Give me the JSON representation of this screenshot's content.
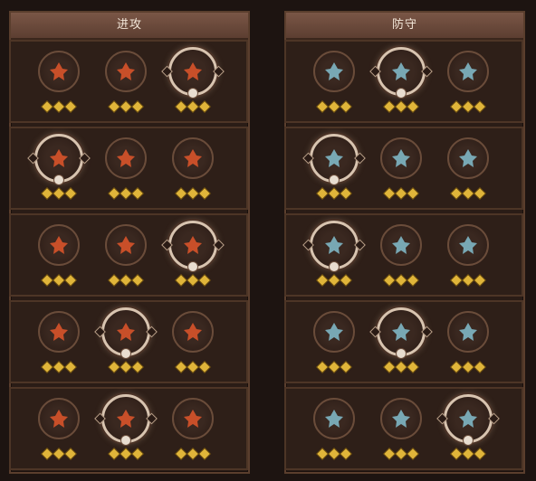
{
  "panels": {
    "attack": {
      "title": "进攻"
    },
    "defense": {
      "title": "防守"
    }
  },
  "colors": {
    "attack_glyph": "#d8532a",
    "attack_glyph_dim": "#b0462a",
    "defense_glyph": "#7fb6c4",
    "pip": "#e0b53a",
    "selected_ring": "#d8c4b0"
  },
  "attack_rows": [
    {
      "nodes": [
        {
          "icon": "crosshair-rune-icon",
          "selected": false
        },
        {
          "icon": "horned-demon-icon",
          "selected": false
        },
        {
          "icon": "flame-fist-icon",
          "selected": true
        }
      ]
    },
    {
      "nodes": [
        {
          "icon": "triple-claw-icon",
          "selected": true
        },
        {
          "icon": "honeycomb-fist-icon",
          "selected": false
        },
        {
          "icon": "fire-warrior-icon",
          "selected": false
        }
      ]
    },
    {
      "nodes": [
        {
          "icon": "bleeding-blade-icon",
          "selected": false
        },
        {
          "icon": "arrow-strike-icon",
          "selected": false
        },
        {
          "icon": "hooded-flame-icon",
          "selected": true
        }
      ]
    },
    {
      "nodes": [
        {
          "icon": "demon-wings-icon",
          "selected": false
        },
        {
          "icon": "flaming-sword-icon",
          "selected": true
        },
        {
          "icon": "burning-figure-icon",
          "selected": false
        }
      ]
    },
    {
      "nodes": [
        {
          "icon": "fire-slash-icon",
          "selected": false
        },
        {
          "icon": "crossed-blades-icon",
          "selected": true
        },
        {
          "icon": "explosion-icon",
          "selected": false
        }
      ]
    }
  ],
  "defense_rows": [
    {
      "nodes": [
        {
          "icon": "heart-shield-icon",
          "selected": false
        },
        {
          "icon": "wind-fist-icon",
          "selected": true
        },
        {
          "icon": "vortex-ring-icon",
          "selected": false
        }
      ]
    },
    {
      "nodes": [
        {
          "icon": "sparkle-potion-icon",
          "selected": true
        },
        {
          "icon": "quarter-shield-icon",
          "selected": false
        },
        {
          "icon": "crest-shield-icon",
          "selected": false
        }
      ]
    },
    {
      "nodes": [
        {
          "icon": "lightning-cloud-icon",
          "selected": true
        },
        {
          "icon": "diamond-cluster-icon",
          "selected": false
        },
        {
          "icon": "guardian-figure-icon",
          "selected": false
        }
      ]
    },
    {
      "nodes": [
        {
          "icon": "swirl-icon",
          "selected": false
        },
        {
          "icon": "rune-tablet-icon",
          "selected": true
        },
        {
          "icon": "sword-rack-icon",
          "selected": false
        }
      ]
    },
    {
      "nodes": [
        {
          "icon": "wind-slash-icon",
          "selected": false
        },
        {
          "icon": "orb-cluster-icon",
          "selected": false
        },
        {
          "icon": "spirit-icon",
          "selected": true
        }
      ]
    }
  ]
}
